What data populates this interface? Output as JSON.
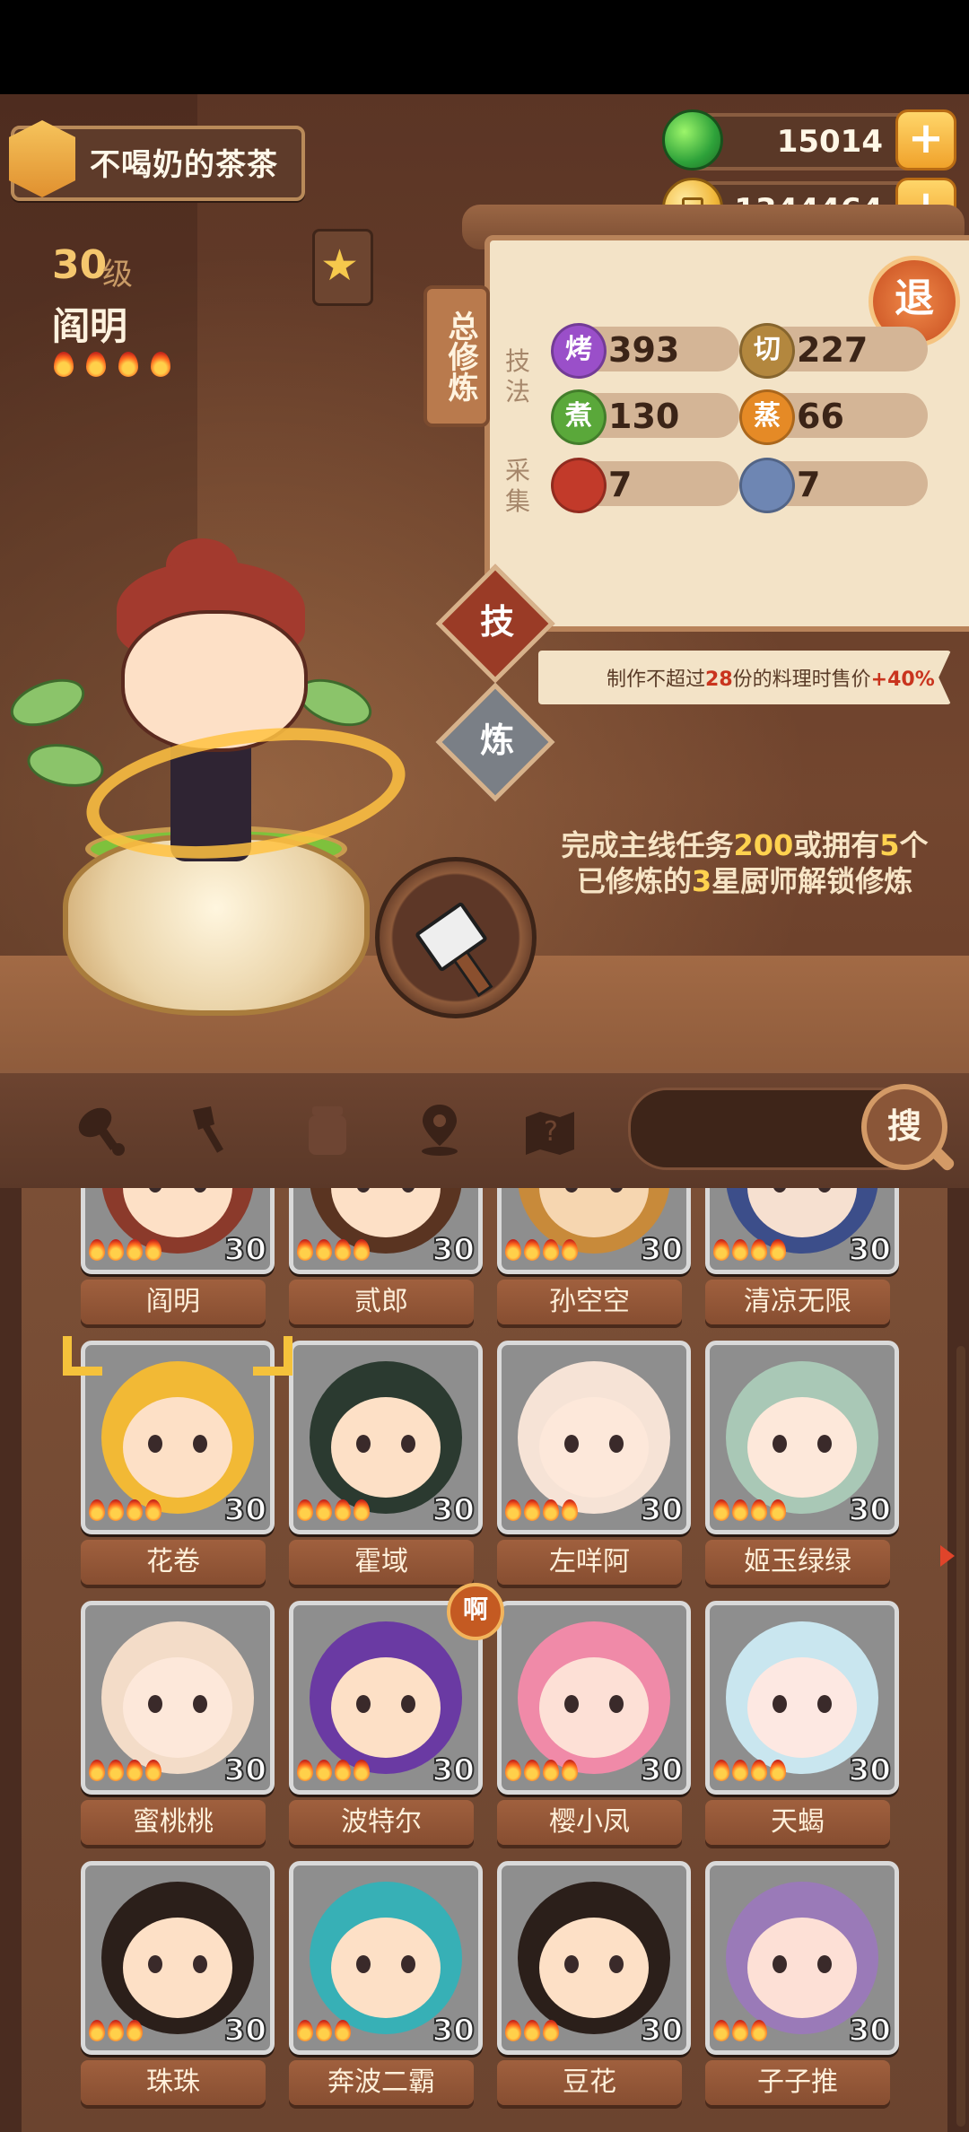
{
  "player": {
    "name": "不喝奶的茶茶"
  },
  "currency": {
    "gems": "15014",
    "coins": "1344464",
    "plus": "+"
  },
  "chef": {
    "level": "30",
    "level_unit": "级",
    "name": "阎明",
    "stars": 4
  },
  "panel": {
    "tab_label": "总修炼",
    "exit_label": "退",
    "skill_section": "技法",
    "gather_section": "采集",
    "skills": [
      {
        "icon": "烤",
        "value": "393",
        "color": "#9a4fc9"
      },
      {
        "icon": "切",
        "value": "227",
        "color": "#b3873e"
      },
      {
        "icon": "煮",
        "value": "130",
        "color": "#5aa83a"
      },
      {
        "icon": "蒸",
        "value": "66",
        "color": "#e58a26"
      }
    ],
    "gather": [
      {
        "icon": "meat-icon",
        "value": "7",
        "color": "#c23a2a"
      },
      {
        "icon": "fish-icon",
        "value": "7",
        "color": "#6e86b3"
      }
    ]
  },
  "modes": {
    "skill_button": "技",
    "cultivate_button": "炼"
  },
  "ribbon": {
    "prefix": "制作不超过",
    "count": "28",
    "middle": "份的料理时售价",
    "bonus": "+40%"
  },
  "unlock": {
    "line1_a": "完成主线任务",
    "line1_b": "200",
    "line1_c": "或拥有",
    "line1_d": "5",
    "line1_e": "个",
    "line2_a": "已修炼的",
    "line2_b": "3",
    "line2_c": "星厨师解锁修炼"
  },
  "filters": [
    {
      "icon": "meat-leg-icon"
    },
    {
      "icon": "shovel-icon"
    },
    {
      "icon": "jar-icon"
    },
    {
      "icon": "location-pin-icon"
    },
    {
      "icon": "map-icon"
    }
  ],
  "search": {
    "button_label": "搜"
  },
  "new_badge": "啊",
  "roster": [
    {
      "name": "阎明",
      "level": "30",
      "stars": 4,
      "bg": "#8e8e8e",
      "hair": "#8b3a2b",
      "skin": "#fde0c6"
    },
    {
      "name": "贰郎",
      "level": "30",
      "stars": 4,
      "bg": "#8e8e8e",
      "hair": "#5a3421",
      "skin": "#fde0c6"
    },
    {
      "name": "孙空空",
      "level": "30",
      "stars": 4,
      "bg": "#8e8e8e",
      "hair": "#c88a3a",
      "skin": "#f6d6b0"
    },
    {
      "name": "清凉无限",
      "level": "30",
      "stars": 4,
      "bg": "#8e8e8e",
      "hair": "#3c4e8a",
      "skin": "#f6e0d0"
    },
    {
      "name": "花卷",
      "level": "30",
      "stars": 4,
      "bg": "#8e8e8e",
      "hair": "#f2b935",
      "skin": "#fde0c6"
    },
    {
      "name": "霍域",
      "level": "30",
      "stars": 4,
      "bg": "#8e8e8e",
      "hair": "#2b3a30",
      "skin": "#fde0c6"
    },
    {
      "name": "左咩阿",
      "level": "30",
      "stars": 4,
      "bg": "#8e8e8e",
      "hair": "#f6e3d6",
      "skin": "#fde8da"
    },
    {
      "name": "姬玉绿绿",
      "level": "30",
      "stars": 4,
      "bg": "#8e8e8e",
      "hair": "#a9c8b6",
      "skin": "#fde8da"
    },
    {
      "name": "蜜桃桃",
      "level": "30",
      "stars": 4,
      "bg": "#8e8e8e",
      "hair": "#f3dcc8",
      "skin": "#fde8da"
    },
    {
      "name": "波特尔",
      "level": "30",
      "stars": 4,
      "bg": "#8e8e8e",
      "hair": "#6a3aa3",
      "skin": "#fde0c6"
    },
    {
      "name": "樱小凤",
      "level": "30",
      "stars": 4,
      "bg": "#8e8e8e",
      "hair": "#f08aa8",
      "skin": "#fde0d6"
    },
    {
      "name": "天蝎",
      "level": "30",
      "stars": 4,
      "bg": "#8e8e8e",
      "hair": "#c9e6ef",
      "skin": "#fde8e2"
    },
    {
      "name": "珠珠",
      "level": "30",
      "stars": 3,
      "bg": "#8e8e8e",
      "hair": "#2b1f1a",
      "skin": "#fde0c6"
    },
    {
      "name": "奔波二霸",
      "level": "30",
      "stars": 3,
      "bg": "#8e8e8e",
      "hair": "#37b0b6",
      "skin": "#fde0c6"
    },
    {
      "name": "豆花",
      "level": "30",
      "stars": 3,
      "bg": "#8e8e8e",
      "hair": "#2b1f1a",
      "skin": "#fde0c6"
    },
    {
      "name": "子子推",
      "level": "30",
      "stars": 3,
      "bg": "#8e8e8e",
      "hair": "#9a7ab8",
      "skin": "#fde0d6"
    }
  ]
}
